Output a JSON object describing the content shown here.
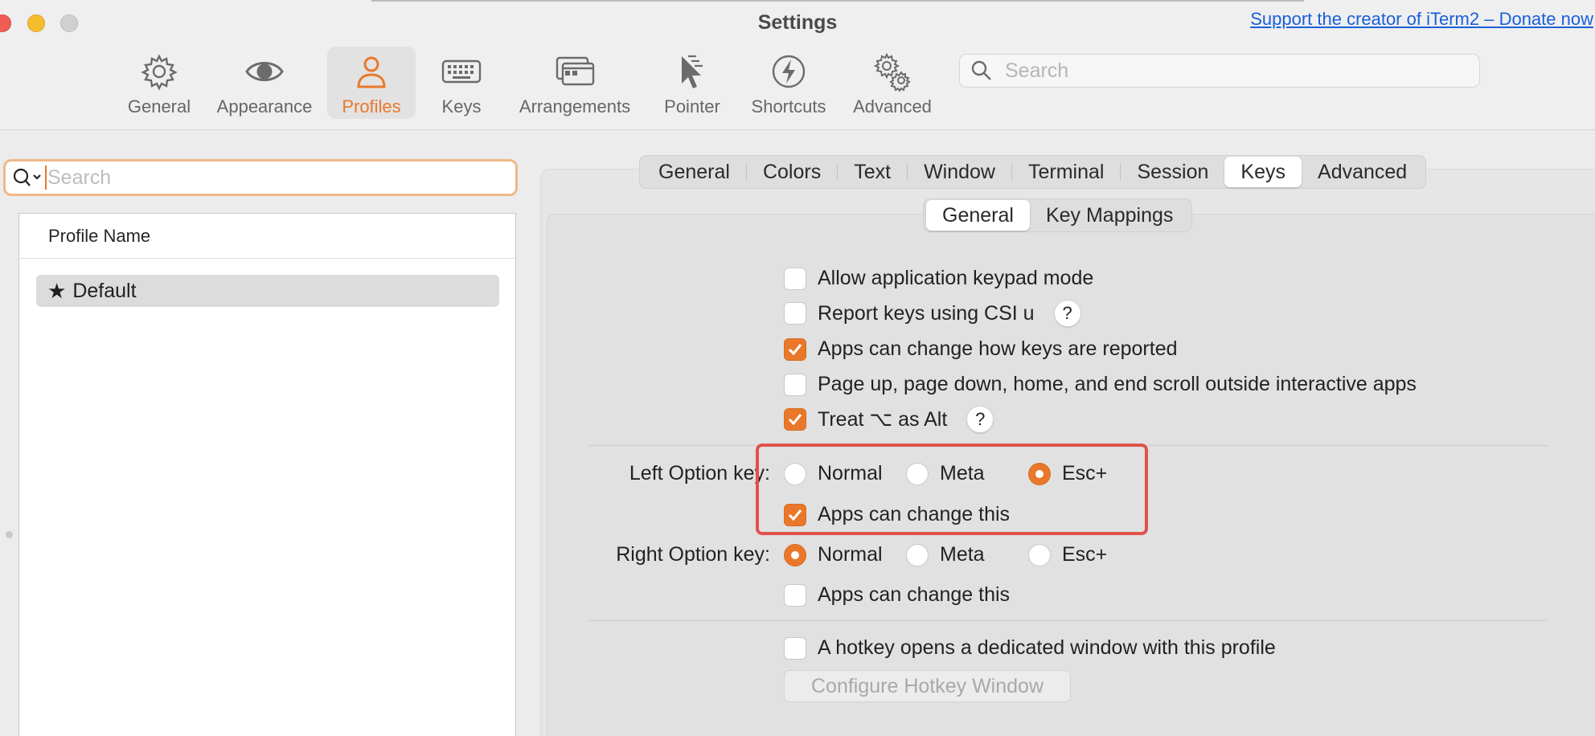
{
  "window": {
    "title": "Settings",
    "donate_link": "Support the creator of iTerm2 – Donate now"
  },
  "toolbar": {
    "items": [
      {
        "label": "General",
        "icon": "gear-icon"
      },
      {
        "label": "Appearance",
        "icon": "eye-icon"
      },
      {
        "label": "Profiles",
        "icon": "person-icon",
        "selected": true
      },
      {
        "label": "Keys",
        "icon": "keyboard-icon"
      },
      {
        "label": "Arrangements",
        "icon": "windows-icon"
      },
      {
        "label": "Pointer",
        "icon": "pointer-icon"
      },
      {
        "label": "Shortcuts",
        "icon": "lightning-icon"
      },
      {
        "label": "Advanced",
        "icon": "gears-icon"
      }
    ],
    "search_placeholder": "Search"
  },
  "profiles": {
    "search_placeholder": "Search",
    "column_header": "Profile Name",
    "rows": [
      {
        "name": "Default",
        "icon": "star-icon",
        "selected": true
      }
    ]
  },
  "tabs": {
    "items": [
      "General",
      "Colors",
      "Text",
      "Window",
      "Terminal",
      "Session",
      "Keys",
      "Advanced"
    ],
    "selected": "Keys"
  },
  "subtabs": {
    "items": [
      "General",
      "Key Mappings"
    ],
    "selected": "General"
  },
  "options": {
    "keypad_mode": {
      "label": "Allow application keypad mode",
      "checked": false
    },
    "csi_u": {
      "label": "Report keys using CSI u",
      "checked": false,
      "help": "?"
    },
    "apps_change_reporting": {
      "label": "Apps can change how keys are reported",
      "checked": true
    },
    "page_scroll": {
      "label": "Page up, page down, home, and end scroll outside interactive apps",
      "checked": false
    },
    "treat_alt": {
      "label": "Treat ⌥ as Alt",
      "checked": true,
      "help": "?"
    }
  },
  "left_option": {
    "label": "Left Option key:",
    "choices": [
      "Normal",
      "Meta",
      "Esc+"
    ],
    "selected": "Esc+",
    "apps_can_change": {
      "label": "Apps can change this",
      "checked": true
    }
  },
  "right_option": {
    "label": "Right Option key:",
    "choices": [
      "Normal",
      "Meta",
      "Esc+"
    ],
    "selected": "Normal",
    "apps_can_change": {
      "label": "Apps can change this",
      "checked": false
    }
  },
  "hotkey": {
    "label": "A hotkey opens a dedicated window with this profile",
    "checked": false,
    "button": "Configure Hotkey Window"
  },
  "colors": {
    "accent": "#e9782a",
    "highlight_box": "#e0524a",
    "link": "#1a5fd9"
  }
}
